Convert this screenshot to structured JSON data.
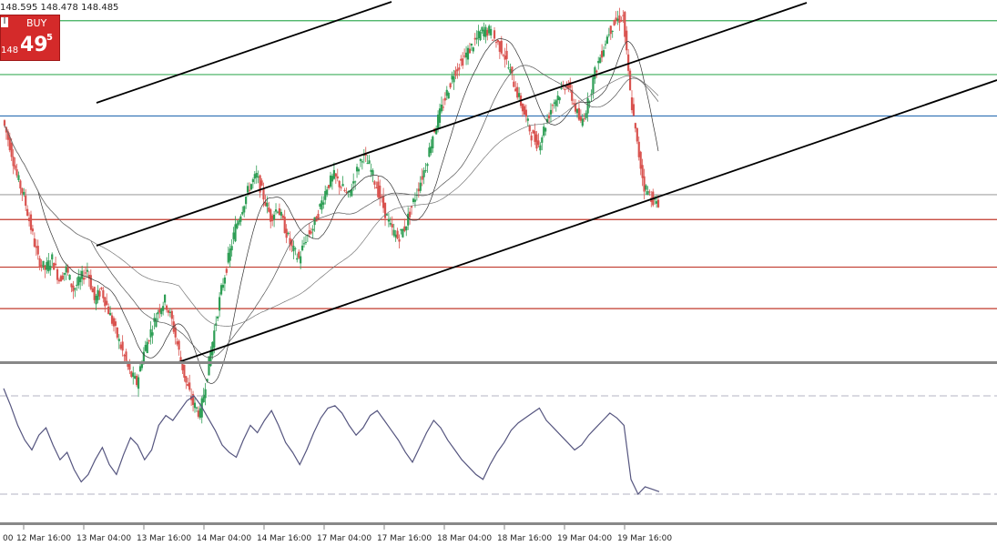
{
  "ohlc_text": "148.595 148.478 148.485",
  "trade_panel": {
    "button_label": "BUY",
    "price_prefix": "148",
    "price_main": "49",
    "price_sup": "5",
    "symbol_marker": "l"
  },
  "colors": {
    "bull": "#2e9e55",
    "bear": "#d9534f",
    "support": "#c0392b",
    "resistance": "#3cae5a",
    "pivot": "#2b6fb3",
    "channel": "#000000",
    "rsi": "#55557f"
  },
  "chart_data": {
    "type": "candlestick",
    "title": "",
    "xlabel": "",
    "ylabel": "",
    "x_tick_labels": [
      "00",
      "12 Mar 16:00",
      "13 Mar 04:00",
      "13 Mar 16:00",
      "14 Mar 04:00",
      "14 Mar 16:00",
      "17 Mar 04:00",
      "17 Mar 16:00",
      "18 Mar 04:00",
      "18 Mar 16:00",
      "19 Mar 04:00",
      "19 Mar 16:00"
    ],
    "price_series": [
      148.62,
      148.5,
      148.35,
      148.25,
      148.1,
      147.95,
      147.9,
      147.95,
      147.85,
      147.9,
      147.8,
      147.85,
      147.9,
      147.75,
      147.8,
      147.7,
      147.6,
      147.5,
      147.4,
      147.35,
      147.5,
      147.6,
      147.7,
      147.75,
      147.65,
      147.5,
      147.35,
      147.25,
      147.2,
      147.4,
      147.6,
      147.8,
      147.95,
      148.1,
      148.2,
      148.3,
      148.35,
      148.25,
      148.15,
      148.2,
      148.1,
      148.0,
      147.95,
      148.05,
      148.1,
      148.2,
      148.3,
      148.35,
      148.3,
      148.25,
      148.35,
      148.45,
      148.4,
      148.3,
      148.2,
      148.1,
      148.05,
      148.1,
      148.2,
      148.3,
      148.4,
      148.55,
      148.65,
      148.75,
      148.85,
      148.9,
      148.95,
      149.0,
      149.05,
      149.05,
      149.0,
      148.95,
      148.85,
      148.75,
      148.65,
      148.55,
      148.5,
      148.6,
      148.7,
      148.75,
      148.8,
      148.7,
      148.6,
      148.7,
      148.85,
      148.95,
      149.05,
      149.1,
      149.12,
      148.75,
      148.5,
      148.3,
      148.25,
      148.2
    ],
    "horizontal_levels": [
      {
        "price": 149.1,
        "kind": "resistance"
      },
      {
        "price": 148.84,
        "kind": "resistance"
      },
      {
        "price": 148.64,
        "kind": "pivot"
      },
      {
        "price": 148.26,
        "kind": "current"
      },
      {
        "price": 148.14,
        "kind": "support"
      },
      {
        "price": 147.91,
        "kind": "support"
      },
      {
        "price": 147.71,
        "kind": "support"
      }
    ],
    "ylim": [
      147.46,
      149.2
    ],
    "rsi_levels": [
      70,
      30
    ],
    "rsi_ylim": [
      20,
      80
    ],
    "rsi_values": [
      73,
      66,
      58,
      52,
      48,
      54,
      57,
      50,
      44,
      47,
      40,
      35,
      38,
      44,
      49,
      42,
      38,
      46,
      53,
      50,
      44,
      48,
      58,
      62,
      60,
      64,
      68,
      70,
      66,
      61,
      56,
      50,
      47,
      45,
      52,
      58,
      55,
      60,
      64,
      58,
      51,
      47,
      42,
      48,
      55,
      61,
      65,
      66,
      63,
      58,
      54,
      57,
      62,
      64,
      60,
      56,
      52,
      47,
      43,
      49,
      55,
      60,
      57,
      52,
      48,
      44,
      41,
      38,
      36,
      42,
      47,
      51,
      56,
      59,
      61,
      63,
      65,
      60,
      57,
      54,
      51,
      48,
      50,
      54,
      57,
      60,
      63,
      61,
      58,
      36,
      30,
      33,
      32,
      31
    ]
  }
}
